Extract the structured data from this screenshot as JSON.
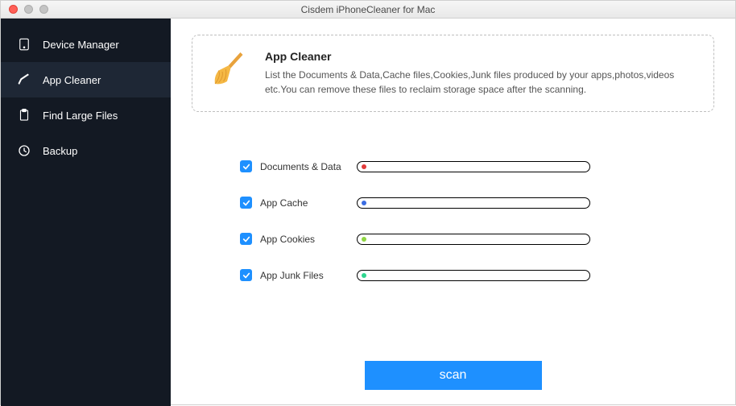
{
  "window": {
    "title": "Cisdem iPhoneCleaner for Mac"
  },
  "sidebar": {
    "items": [
      {
        "label": "Device Manager",
        "icon": "device-icon"
      },
      {
        "label": "App Cleaner",
        "icon": "broom-small-icon"
      },
      {
        "label": "Find Large Files",
        "icon": "clipboard-icon"
      },
      {
        "label": "Backup",
        "icon": "backup-icon"
      }
    ]
  },
  "panel": {
    "title": "App Cleaner",
    "description": "List the Documents & Data,Cache files,Cookies,Junk files produced by your apps,photos,videos etc.You can remove these files to reclaim storage space after the scanning."
  },
  "options": [
    {
      "label": "Documents & Data",
      "checked": true,
      "dot_color": "#e23b3b"
    },
    {
      "label": "App Cache",
      "checked": true,
      "dot_color": "#3b6de2"
    },
    {
      "label": "App Cookies",
      "checked": true,
      "dot_color": "#8fd642"
    },
    {
      "label": "App Junk Files",
      "checked": true,
      "dot_color": "#2fd68f"
    }
  ],
  "actions": {
    "scan": "scan"
  }
}
